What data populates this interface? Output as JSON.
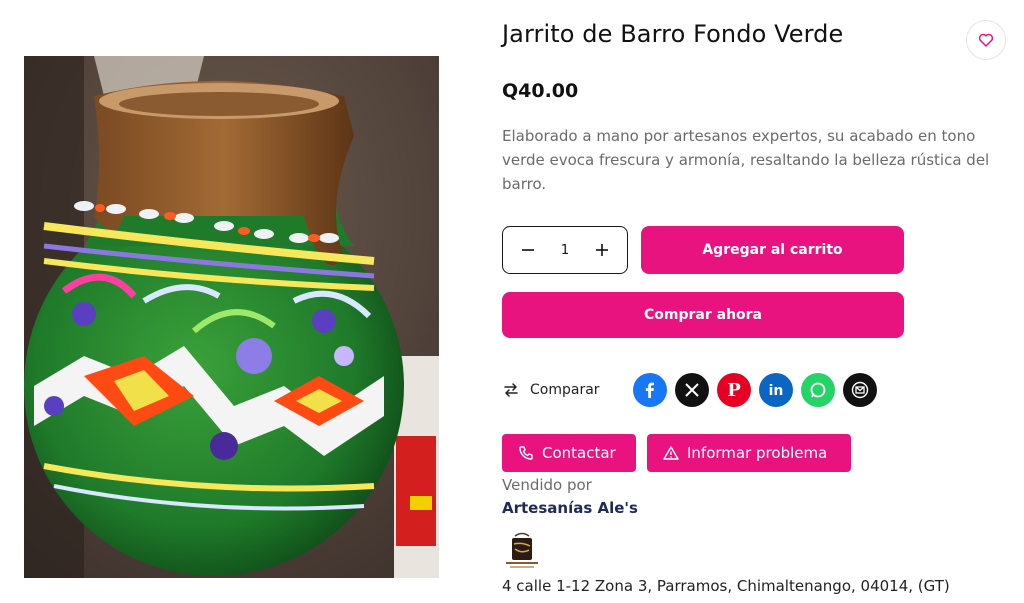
{
  "product": {
    "title": "Jarrito de Barro Fondo Verde",
    "price": "Q40.00",
    "description": "Elaborado a mano por artesanos expertos, su acabado en tono verde evoca frescura y armonía, resaltando la belleza rústica del barro."
  },
  "quantity": {
    "value": "1"
  },
  "buttons": {
    "add_to_cart": "Agregar al carrito",
    "buy_now": "Comprar ahora",
    "compare": "Comparar",
    "contact": "Contactar",
    "report": "Informar problema"
  },
  "share": [
    {
      "icon": "facebook-icon",
      "color": "#1877f2"
    },
    {
      "icon": "x-icon",
      "color": "#111111"
    },
    {
      "icon": "pinterest-icon",
      "color": "#e60023"
    },
    {
      "icon": "linkedin-icon",
      "color": "#0a66c2"
    },
    {
      "icon": "whatsapp-icon",
      "color": "#25d366"
    },
    {
      "icon": "email-icon",
      "color": "#111111"
    }
  ],
  "seller": {
    "sold_by_label": "Vendido por",
    "name": "Artesanías Ale's",
    "address": "4 calle 1-12 Zona 3, Parramos, Chimaltenango, 04014, (GT)"
  },
  "colors": {
    "accent": "#e8137f",
    "seller_name": "#1f2a5a"
  }
}
